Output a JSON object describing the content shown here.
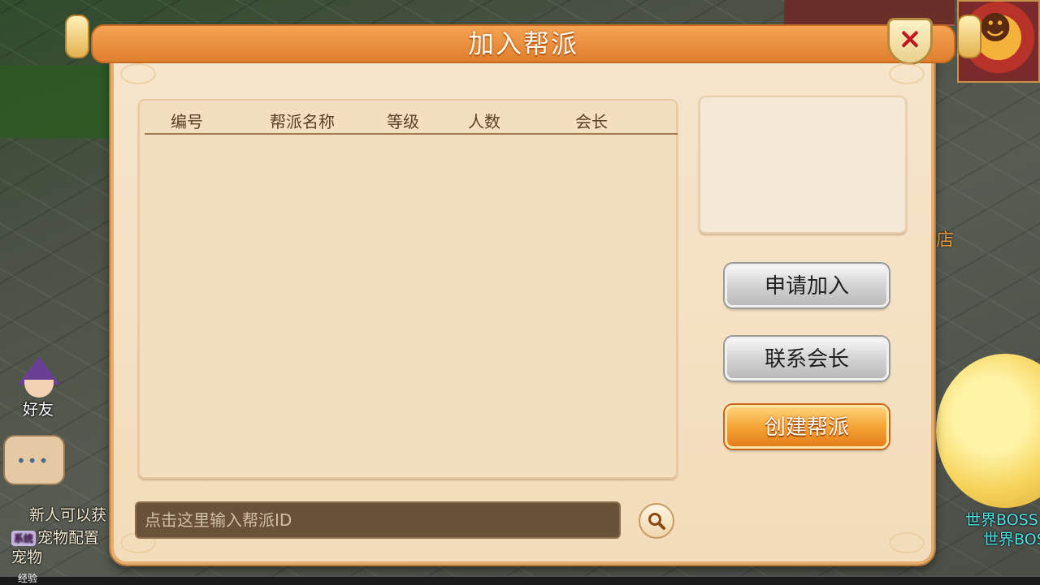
{
  "dialog": {
    "title": "加入帮派",
    "close_icon": "close-icon"
  },
  "guild_list": {
    "columns": [
      "编号",
      "帮派名称",
      "等级",
      "人数",
      "会长"
    ],
    "rows": []
  },
  "actions": {
    "apply_label": "申请加入",
    "contact_label": "联系会长",
    "create_label": "创建帮派"
  },
  "search": {
    "placeholder": "点击这里输入帮派ID",
    "value": "",
    "icon": "search-icon"
  },
  "hud": {
    "friend_label": "好友",
    "shop_label": "店",
    "exp_label": "经验",
    "chat_lines": [
      "新人可以获",
      "宠物配置",
      "宠物"
    ],
    "system_tag": "系统",
    "boss_line_1": "世界BOSS",
    "boss_line_2": "世界BOS"
  },
  "colors": {
    "title_bar": "#e88a34",
    "panel": "#f3dfbf",
    "primary_button": "#f7a436",
    "secondary_button": "#d6d6d6",
    "close_x": "#d3121f"
  }
}
